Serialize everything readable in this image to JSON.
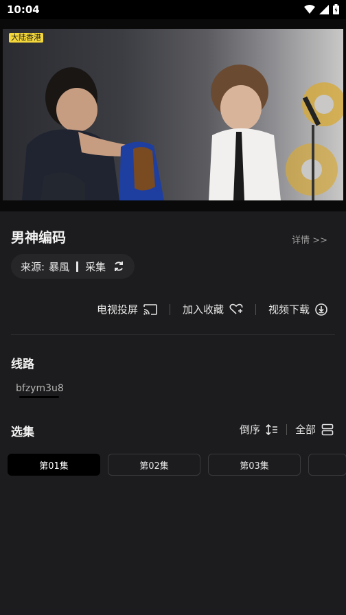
{
  "status_bar": {
    "time": "10:04"
  },
  "player": {
    "watermark": "大陆香港"
  },
  "show": {
    "title": "男神编码",
    "details_link": "详情 >>"
  },
  "source": {
    "label": "来源:",
    "primary": "暴風",
    "secondary": "采集"
  },
  "actions": {
    "cast": "电视投屏",
    "favorite": "加入收藏",
    "download": "视频下载"
  },
  "lines": {
    "title": "线路",
    "items": [
      {
        "label": "bfzym3u8"
      }
    ]
  },
  "episodes": {
    "title": "选集",
    "sort_label": "倒序",
    "all_label": "全部",
    "items": [
      {
        "label": "第01集"
      },
      {
        "label": "第02集"
      },
      {
        "label": "第03集"
      }
    ]
  }
}
